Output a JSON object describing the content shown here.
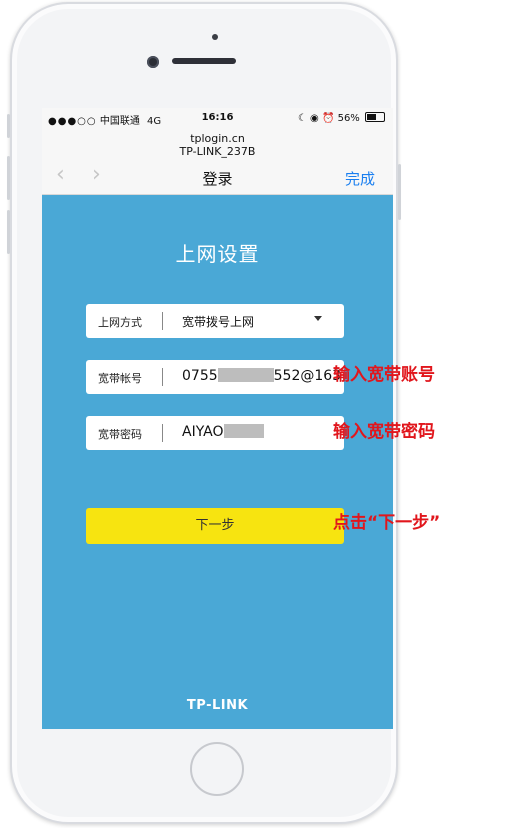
{
  "status_bar": {
    "signal": "●●●○○",
    "carrier": "中国联通",
    "network": "4G",
    "time": "16:16",
    "battery": "56%"
  },
  "browser": {
    "url": "tplogin.cn",
    "site_name": "TP-LINK_237B",
    "title": "登录",
    "done_label": "完成"
  },
  "page": {
    "title": "上网设置",
    "connection_type": {
      "label": "上网方式",
      "value": "宽带拨号上网"
    },
    "account": {
      "label": "宽带帐号",
      "value_start": "0755",
      "value_end": "552@163"
    },
    "password": {
      "label": "宽带密码",
      "value_start": "AIYAO"
    },
    "next_button": "下一步",
    "brand": "TP-LINK"
  },
  "annotations": {
    "account": "输入宽带账号",
    "password": "输入宽带密码",
    "next": "点击“下一步”"
  },
  "colors": {
    "screen_bg": "#4aa8d6",
    "button_bg": "#f7e410",
    "annotation": "#e1161c",
    "done_link": "#1a7ff0"
  }
}
